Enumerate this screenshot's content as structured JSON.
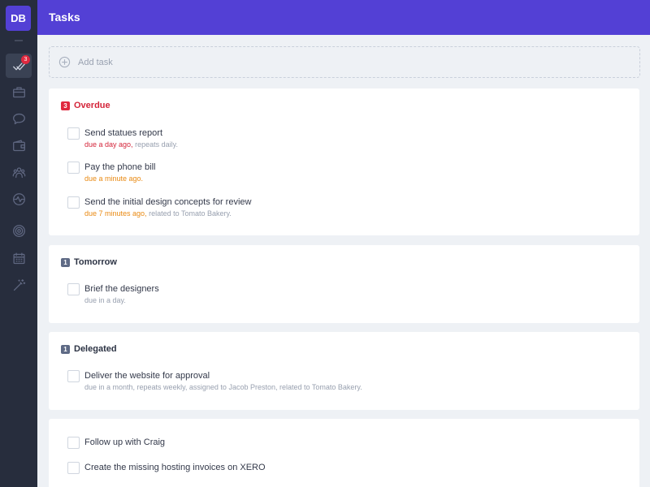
{
  "user": {
    "initials": "DB"
  },
  "sidebar": {
    "badge_count": "3",
    "items": [
      {
        "name": "tasks",
        "icon": "check-icon"
      },
      {
        "name": "projects",
        "icon": "briefcase-icon"
      },
      {
        "name": "messages",
        "icon": "chat-icon"
      },
      {
        "name": "wallet",
        "icon": "wallet-icon"
      },
      {
        "name": "people",
        "icon": "people-icon"
      },
      {
        "name": "activity",
        "icon": "pulse-icon"
      },
      {
        "name": "goals",
        "icon": "target-icon"
      },
      {
        "name": "calendar",
        "icon": "calendar-icon"
      },
      {
        "name": "magic",
        "icon": "wand-icon"
      }
    ]
  },
  "header": {
    "title": "Tasks"
  },
  "add_task": {
    "label": "Add task"
  },
  "sections": {
    "overdue": {
      "count": "3",
      "title": "Overdue",
      "tasks": [
        {
          "title": "Send statues report",
          "due": "due a day ago,",
          "extra": "repeats daily."
        },
        {
          "title": "Pay the phone bill",
          "due": "due a minute ago."
        },
        {
          "title": "Send the initial design concepts for review",
          "due": "due 7 minutes ago,",
          "extra": "related to Tomato Bakery."
        }
      ]
    },
    "tomorrow": {
      "count": "1",
      "title": "Tomorrow",
      "tasks": [
        {
          "title": "Brief the designers",
          "meta": "due in a day."
        }
      ]
    },
    "delegated": {
      "count": "1",
      "title": "Delegated",
      "tasks": [
        {
          "title": "Deliver the website for approval",
          "meta": "due in a month,  repeats weekly,  assigned to Jacob Preston, related to Tomato Bakery."
        }
      ]
    },
    "other": {
      "tasks": [
        {
          "title": "Follow up with Craig"
        },
        {
          "title": "Create the missing hosting invoices on XERO"
        }
      ]
    }
  },
  "colors": {
    "accent": "#5340d5",
    "sidebar": "#272d3d",
    "overdue_red": "#d4253a",
    "due_orange": "#e98a13",
    "background": "#eef1f5"
  }
}
